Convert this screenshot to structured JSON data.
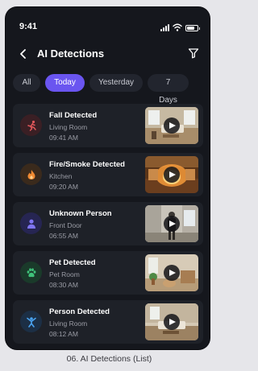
{
  "status_bar": {
    "time": "9:41",
    "icons": [
      "signal-icon",
      "wifi-icon",
      "battery-icon"
    ]
  },
  "header": {
    "title": "AI Detections",
    "back_icon": "chevron-left-icon",
    "filter_icon": "filter-icon"
  },
  "tabs": [
    {
      "label": "All",
      "active": false
    },
    {
      "label": "Today",
      "active": true
    },
    {
      "label": "Yesterday",
      "active": false
    },
    {
      "label": "7 Days",
      "active": false
    }
  ],
  "detections": [
    {
      "title": "Fall Detected",
      "room": "Living Room",
      "time": "09:41 AM",
      "icon": "person-falling-icon",
      "icon_color": "#e0575a",
      "icon_bg": "#3a1f24",
      "scene": "living-room"
    },
    {
      "title": "Fire/Smoke Detected",
      "room": "Kitchen",
      "time": "09:20 AM",
      "icon": "flame-icon",
      "icon_color": "#f08a32",
      "icon_bg": "#3a2a1c",
      "scene": "kitchen-fire"
    },
    {
      "title": "Unknown Person",
      "room": "Front Door",
      "time": "06:55 AM",
      "icon": "person-icon",
      "icon_color": "#7f75f5",
      "icon_bg": "#262552",
      "scene": "front-door"
    },
    {
      "title": "Pet Detected",
      "room": "Pet Room",
      "time": "08:30 AM",
      "icon": "paw-icon",
      "icon_color": "#3fc27a",
      "icon_bg": "#1a3a2a",
      "scene": "pet-room"
    },
    {
      "title": "Person Detected",
      "room": "Living Room",
      "time": "08:12 AM",
      "icon": "person-arms-up-icon",
      "icon_color": "#4aa3f0",
      "icon_bg": "#1c2f45",
      "scene": "living-room-2"
    }
  ],
  "play_icon": "play-icon",
  "caption": "06. AI Detections (List)",
  "colors": {
    "accent": "#6a55f0",
    "background": "#15171d",
    "card": "#1e2128"
  }
}
